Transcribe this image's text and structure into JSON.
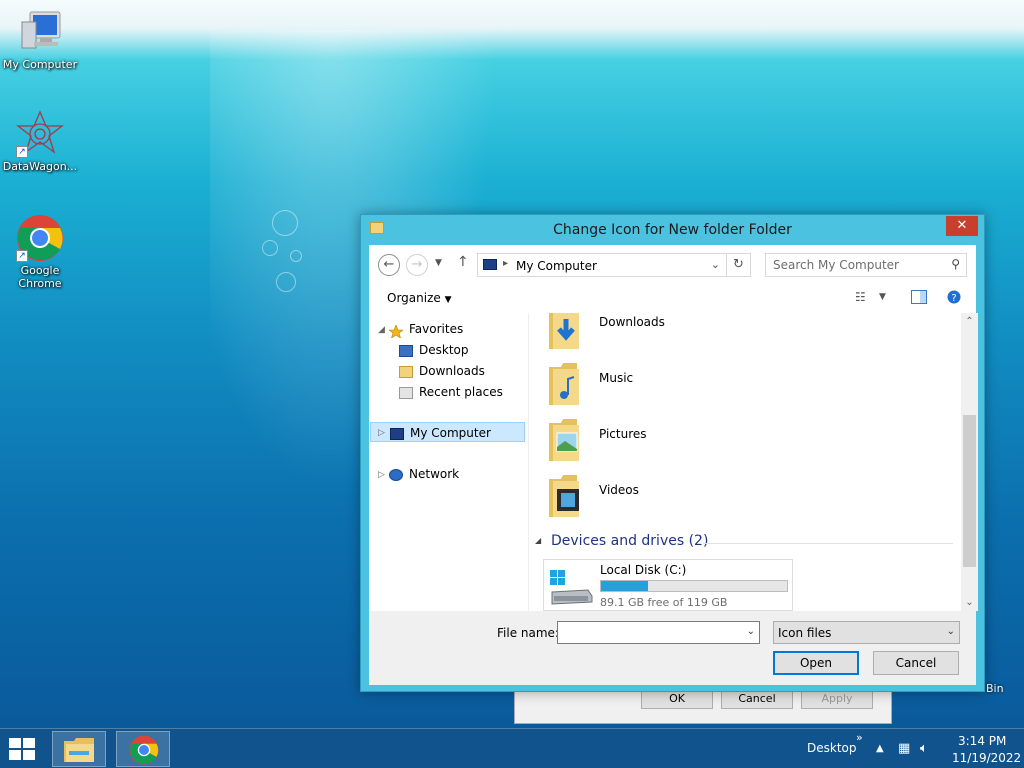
{
  "desktop": {
    "icons": [
      {
        "label": "My Computer"
      },
      {
        "label": "DataWagon..."
      },
      {
        "label": "Google Chrome"
      }
    ],
    "recycle_bin_label": "Bin"
  },
  "background_dialog": {
    "ok_label": "OK",
    "cancel_label": "Cancel",
    "apply_label": "Apply"
  },
  "dialog": {
    "title": "Change Icon for New folder Folder",
    "close_glyph": "✕",
    "address": {
      "path": "My Computer"
    },
    "search": {
      "placeholder": "Search My Computer"
    },
    "toolbar": {
      "organize_label": "Organize"
    },
    "nav_pane": {
      "favorites_label": "Favorites",
      "favorites_items": [
        {
          "label": "Desktop"
        },
        {
          "label": "Downloads"
        },
        {
          "label": "Recent places"
        }
      ],
      "my_computer_label": "My Computer",
      "network_label": "Network"
    },
    "content": {
      "folders": [
        {
          "label": "Downloads"
        },
        {
          "label": "Music"
        },
        {
          "label": "Pictures"
        },
        {
          "label": "Videos"
        }
      ],
      "devices_group_label": "Devices and drives (2)",
      "drive": {
        "name": "Local Disk (C:)",
        "free_text": "89.1 GB free of 119 GB",
        "used_fraction": 0.25
      }
    },
    "footer": {
      "file_name_label": "File name:",
      "file_name_value": "",
      "file_type_value": "Icon files",
      "open_label": "Open",
      "cancel_label": "Cancel"
    }
  },
  "taskbar": {
    "desktop_label": "Desktop",
    "time": "3:14 PM",
    "date": "11/19/2022"
  },
  "colors": {
    "dialog_frame": "#4bc3e0",
    "close_red": "#c7402d",
    "selection_blue": "#cce8ff",
    "drive_fill": "#26a0da",
    "group_header_text": "#1e3287"
  }
}
